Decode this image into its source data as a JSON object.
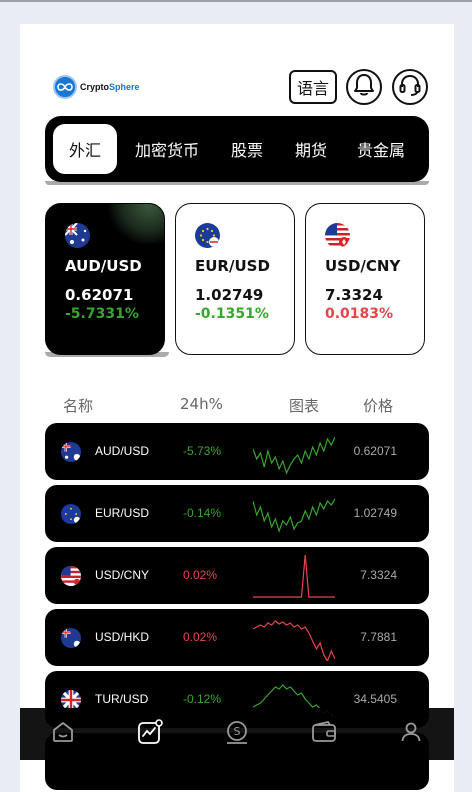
{
  "header": {
    "brand_prefix": "Crypto",
    "brand_suffix": "Sphere",
    "language_label": "语言"
  },
  "tabs": [
    {
      "label": "外汇",
      "active": true
    },
    {
      "label": "加密货币",
      "active": false
    },
    {
      "label": "股票",
      "active": false
    },
    {
      "label": "期货",
      "active": false
    },
    {
      "label": "贵金属",
      "active": false
    }
  ],
  "cards": [
    {
      "name": "AUD/USD",
      "price": "0.62071",
      "change": "-5.7331%",
      "direction": "down",
      "flag": "AU"
    },
    {
      "name": "EUR/USD",
      "price": "1.02749",
      "change": "-0.1351%",
      "direction": "down",
      "flag": "EU"
    },
    {
      "name": "USD/CNY",
      "price": "7.3324",
      "change": "0.0183%",
      "direction": "up",
      "flag": "US"
    }
  ],
  "list_header": {
    "name": "名称",
    "change": "24h%",
    "chart": "图表",
    "price": "价格"
  },
  "rows": [
    {
      "name": "AUD/USD",
      "change": "-5.73%",
      "price": "0.62071",
      "direction": "down",
      "flag": "AU",
      "spark": [
        20,
        30,
        24,
        38,
        22,
        34,
        28,
        40,
        32,
        44,
        36,
        30,
        26,
        34,
        22,
        30,
        18,
        26,
        14,
        22,
        10,
        16,
        8
      ]
    },
    {
      "name": "EUR/USD",
      "change": "-0.14%",
      "price": "1.02749",
      "direction": "down",
      "flag": "EU",
      "spark": [
        10,
        24,
        16,
        30,
        22,
        36,
        28,
        40,
        30,
        34,
        26,
        38,
        32,
        30,
        20,
        28,
        16,
        24,
        12,
        18,
        10,
        14,
        8
      ]
    },
    {
      "name": "USD/CNY",
      "change": "0.02%",
      "price": "7.3324",
      "direction": "up",
      "flag": "US",
      "spark": [
        44,
        44,
        44,
        44,
        44,
        44,
        44,
        44,
        44,
        44,
        44,
        44,
        44,
        44,
        2,
        44,
        44,
        44,
        44,
        44,
        44,
        44,
        44
      ]
    },
    {
      "name": "USD/HKD",
      "change": "0.02%",
      "price": "7.7881",
      "direction": "up",
      "flag": "AU",
      "spark": [
        14,
        12,
        10,
        12,
        8,
        10,
        6,
        9,
        7,
        10,
        8,
        12,
        10,
        14,
        12,
        18,
        26,
        34,
        28,
        40,
        46,
        36,
        44
      ]
    },
    {
      "name": "TUR/USD",
      "change": "-0.12%",
      "price": "34.5405",
      "direction": "down",
      "flag": "GB",
      "spark": [
        30,
        28,
        26,
        22,
        18,
        14,
        10,
        12,
        8,
        12,
        10,
        14,
        18,
        16,
        22,
        26,
        30,
        28,
        32,
        36,
        34,
        38,
        40
      ]
    }
  ],
  "nav": [
    {
      "name": "home",
      "active": false
    },
    {
      "name": "market",
      "active": true
    },
    {
      "name": "trade",
      "active": false
    },
    {
      "name": "wallet",
      "active": false
    },
    {
      "name": "profile",
      "active": false
    }
  ],
  "colors": {
    "up": "#e5464c",
    "down": "#37a52e",
    "card_bg_dark": "#000000"
  }
}
